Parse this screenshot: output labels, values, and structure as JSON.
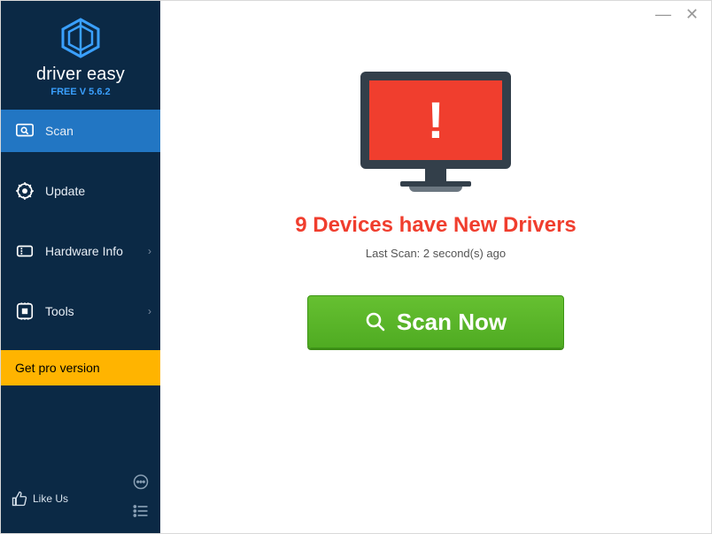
{
  "window": {
    "minimize_glyph": "—",
    "close_glyph": "✕"
  },
  "brand": {
    "name": "driver easy",
    "version_line": "FREE V 5.6.2"
  },
  "sidebar": {
    "items": [
      {
        "label": "Scan",
        "icon": "scan-icon",
        "active": true,
        "chevron": false
      },
      {
        "label": "Update",
        "icon": "update-icon",
        "active": false,
        "chevron": false
      },
      {
        "label": "Hardware Info",
        "icon": "hardware-info-icon",
        "active": false,
        "chevron": true
      },
      {
        "label": "Tools",
        "icon": "tools-icon",
        "active": false,
        "chevron": true
      }
    ],
    "pro_button": "Get pro version",
    "like_label": "Like Us"
  },
  "main": {
    "alert_glyph": "!",
    "status_title": "9 Devices have New Drivers",
    "device_count": 9,
    "last_scan": "Last Scan: 2 second(s) ago",
    "scan_button": "Scan Now"
  },
  "colors": {
    "sidebar_bg": "#0b2945",
    "sidebar_active": "#2276c3",
    "pro_button_bg": "#ffb400",
    "alert_red": "#f03e2e",
    "scan_green": "#58b528",
    "brand_version": "#3aa0ff"
  }
}
